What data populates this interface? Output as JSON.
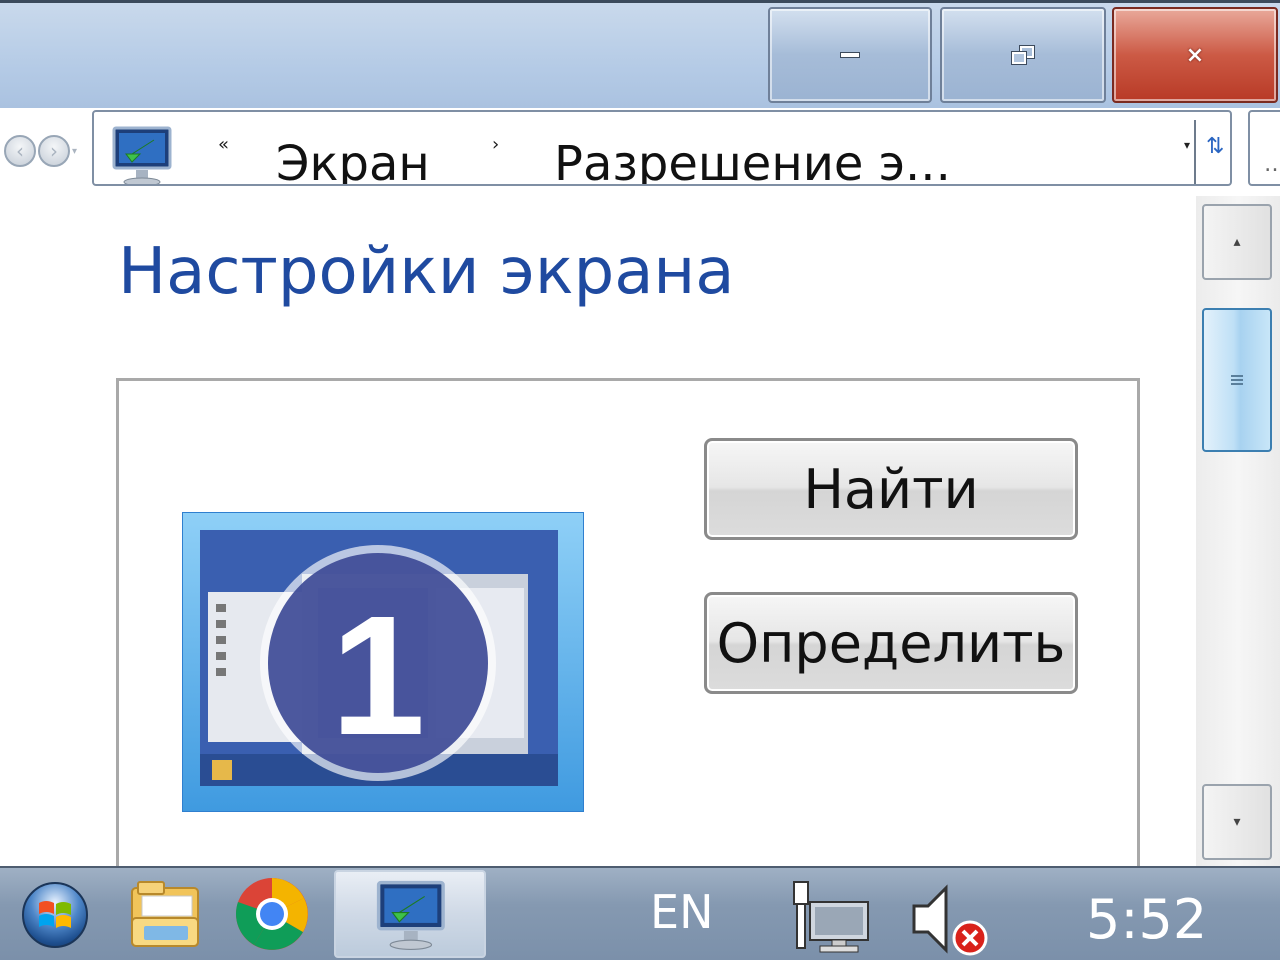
{
  "window": {
    "minimize_icon": "minimize-icon",
    "maximize_icon": "restore-icon",
    "close_icon": "close-icon",
    "close_glyph": "×"
  },
  "addressbar": {
    "overflow_chevron": "«",
    "breadcrumbs": [
      "Экран",
      "Разрешение э..."
    ],
    "separator": "›"
  },
  "page": {
    "title": "Настройки экрана",
    "monitor_number": "1",
    "buttons": {
      "find": "Найти",
      "identify": "Определить"
    }
  },
  "taskbar": {
    "language": "EN",
    "clock": "5:52",
    "apps": [
      "start-orb",
      "file-explorer",
      "chrome",
      "display-settings"
    ],
    "tray_icons": [
      "network-icon",
      "volume-muted-icon"
    ]
  },
  "colors": {
    "title_accent": "#1f4aa0",
    "close_button": "#c64a36",
    "taskbar": "#8599b1"
  }
}
